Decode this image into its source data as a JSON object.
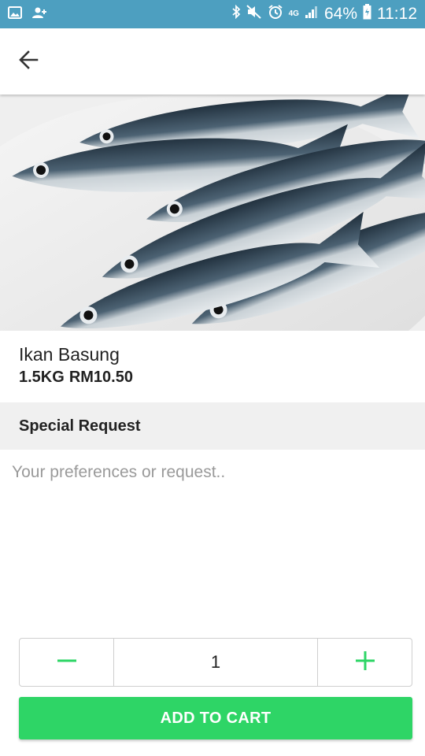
{
  "status_bar": {
    "network": "4G",
    "battery": "64%",
    "time": "11:12",
    "icons": [
      "image-icon",
      "person-add-icon",
      "bluetooth-icon",
      "mute-icon",
      "alarm-icon",
      "signal-icon",
      "battery-icon"
    ]
  },
  "header": {
    "back_icon": "arrow-left-icon"
  },
  "product": {
    "image_icon": "fish-photo",
    "name": "Ikan Basung",
    "weight": "1.5KG",
    "price": "RM10.50"
  },
  "special_request": {
    "title": "Special Request",
    "placeholder": "Your preferences or request..",
    "value": ""
  },
  "quantity": {
    "value": "1",
    "minus_icon": "minus-icon",
    "plus_icon": "plus-icon"
  },
  "cta": {
    "label": "ADD TO CART"
  },
  "colors": {
    "status_bar": "#4d9fc0",
    "accent_green": "#2ed566",
    "section_bg": "#f0f0f0"
  }
}
